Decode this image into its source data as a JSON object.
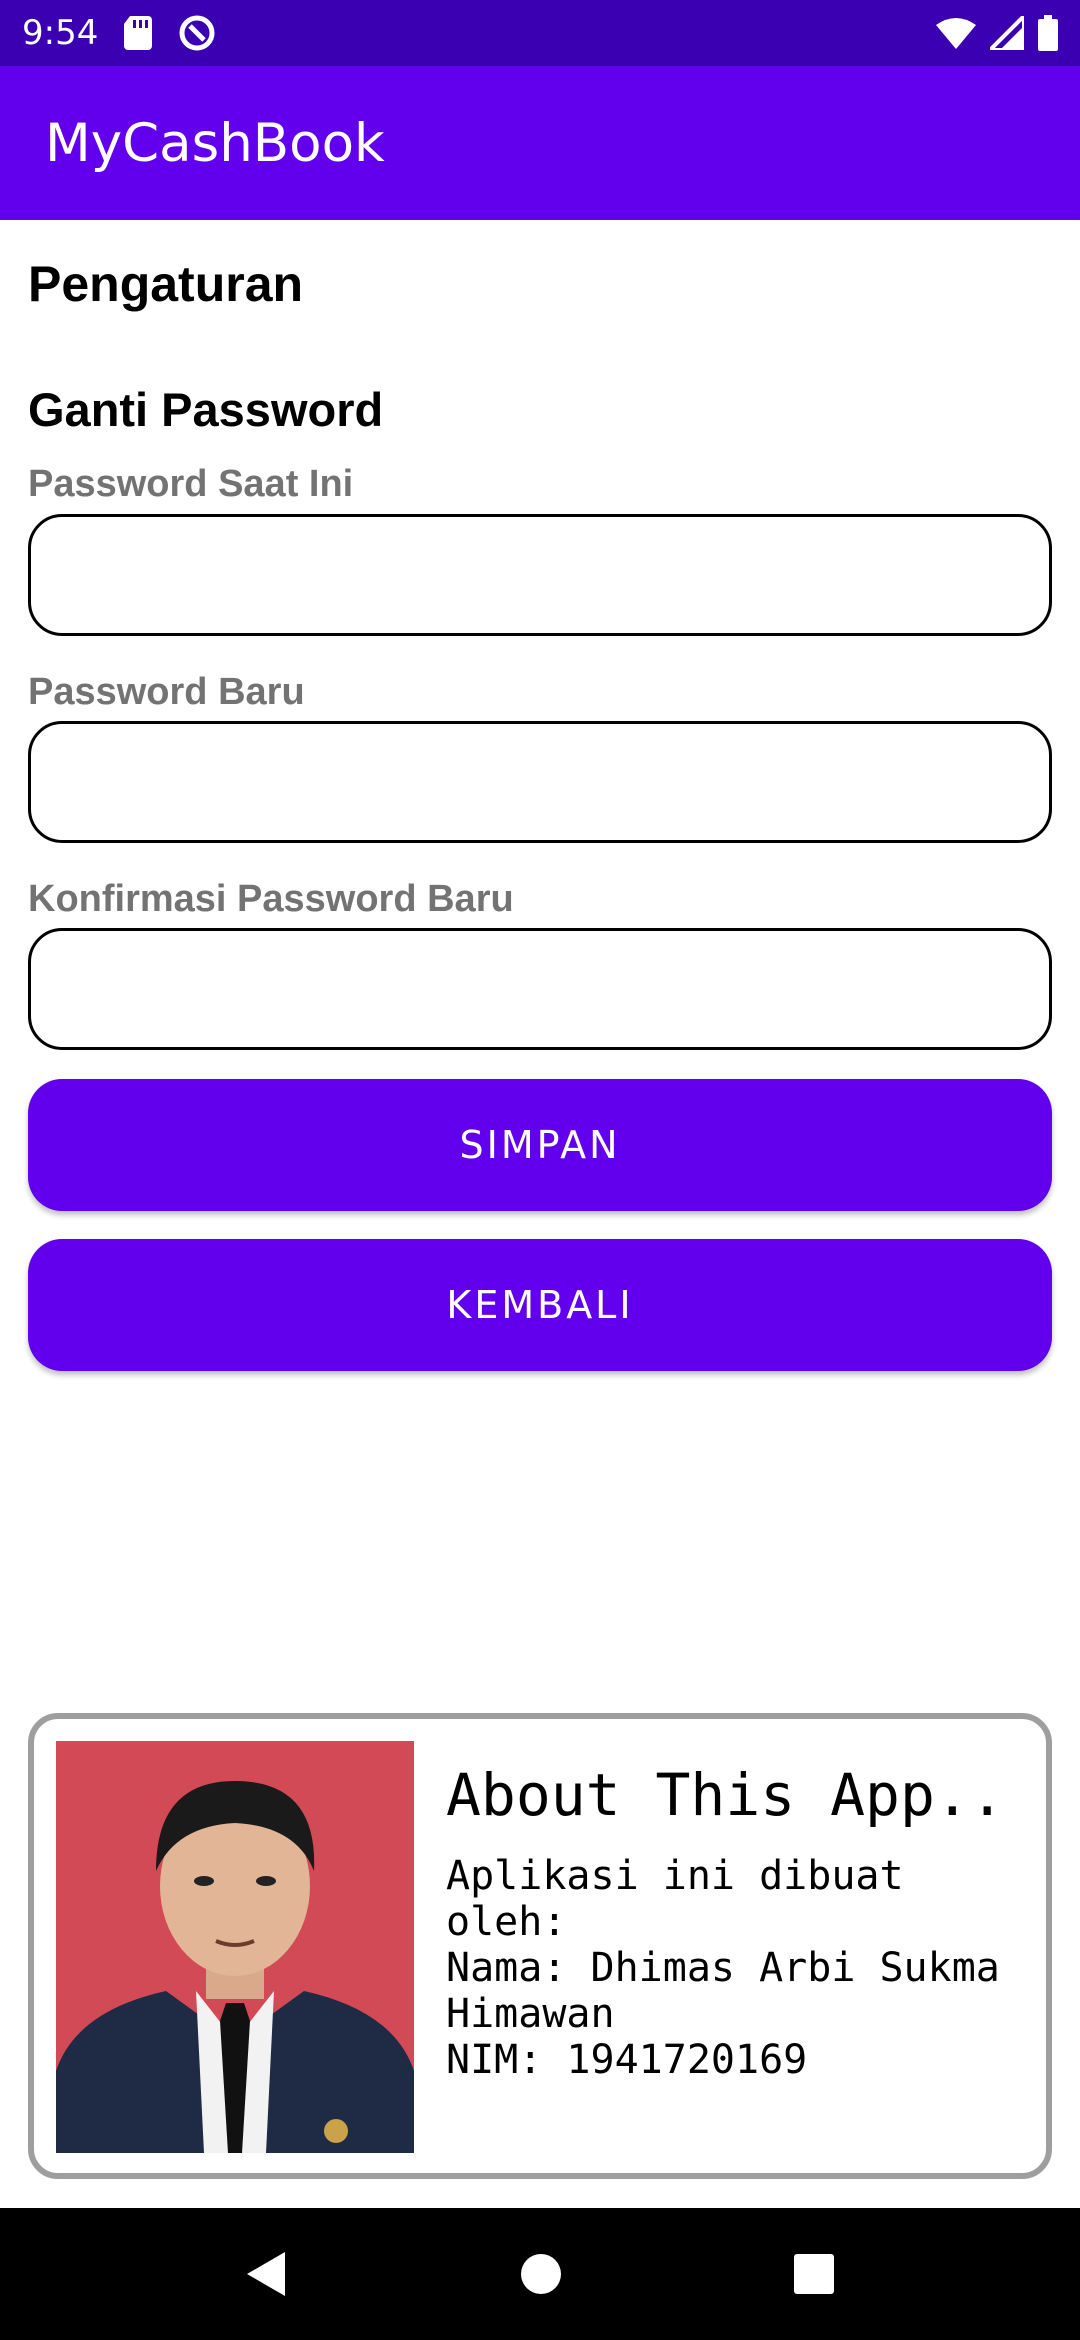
{
  "status_bar": {
    "time": "9:54",
    "icons": [
      "sd-card-icon",
      "data-saver-icon",
      "wifi-icon",
      "signal-icon",
      "battery-icon"
    ]
  },
  "app_bar": {
    "title": "MyCashBook"
  },
  "page": {
    "title": "Pengaturan",
    "section_title": "Ganti Password",
    "fields": [
      {
        "label": "Password Saat Ini",
        "value": ""
      },
      {
        "label": "Password Baru",
        "value": ""
      },
      {
        "label": "Konfirmasi Password Baru",
        "value": ""
      }
    ],
    "buttons": {
      "save": "SIMPAN",
      "back": "KEMBALI"
    }
  },
  "about": {
    "heading": "About This App..",
    "lines": [
      "Aplikasi ini dibuat oleh:",
      "Nama: Dhimas Arbi Sukma Himawan",
      "NIM: 1941720169"
    ]
  },
  "nav_bar": {
    "icons": [
      "back-icon",
      "home-icon",
      "recents-icon"
    ]
  },
  "colors": {
    "primary": "#6200ee",
    "status_bar": "#3a00b2",
    "label_gray": "#737373",
    "card_border": "#9e9e9e"
  }
}
